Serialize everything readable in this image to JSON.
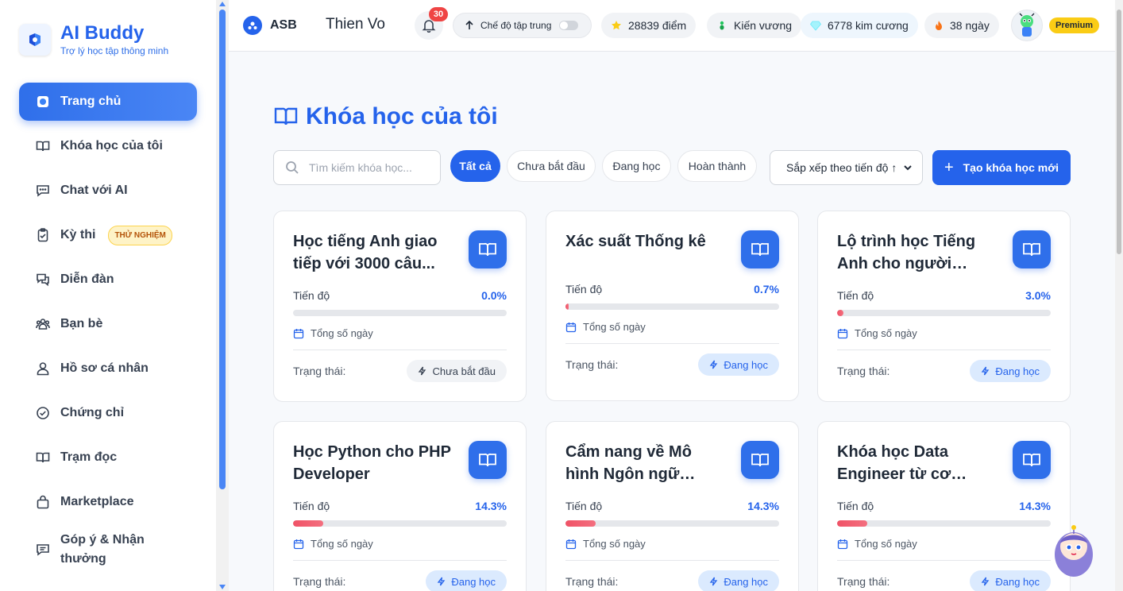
{
  "brand": {
    "title": "AI Buddy",
    "subtitle": "Trợ lý học tập thông minh"
  },
  "sidebar": {
    "items": [
      {
        "label": "Trang chủ",
        "icon": "home-icon",
        "active": true
      },
      {
        "label": "Khóa học của tôi",
        "icon": "book-icon"
      },
      {
        "label": "Chat với AI",
        "icon": "chat-icon"
      },
      {
        "label": "Kỳ thi",
        "icon": "clipboard-check-icon",
        "badge": "THỬ NGHIỆM"
      },
      {
        "label": "Diễn đàn",
        "icon": "forum-icon"
      },
      {
        "label": "Bạn bè",
        "icon": "users-icon"
      },
      {
        "label": "Hồ sơ cá nhân",
        "icon": "user-icon"
      },
      {
        "label": "Chứng chỉ",
        "icon": "check-circle-icon"
      },
      {
        "label": "Trạm đọc",
        "icon": "book-open-icon"
      },
      {
        "label": "Marketplace",
        "icon": "bag-icon"
      },
      {
        "label": "Góp ý & Nhận thưởng",
        "icon": "feedback-icon"
      }
    ]
  },
  "header": {
    "org": "ASB",
    "user": "Thien Vo",
    "notifications": "30",
    "focus_mode": "Chế độ tập trung",
    "points": "28839 điểm",
    "rank": "Kiến vương",
    "diamonds": "6778 kim cương",
    "streak": "38 ngày",
    "plan": "Premium"
  },
  "page": {
    "title": "Khóa học của tôi",
    "search_placeholder": "Tìm kiếm khóa học...",
    "filters": [
      "Tất cả",
      "Chưa bắt đầu",
      "Đang học",
      "Hoàn thành"
    ],
    "sort": "Sắp xếp theo tiến độ ↑",
    "create": "Tạo khóa học mới"
  },
  "card_labels": {
    "progress": "Tiến độ",
    "days": "Tổng số ngày",
    "status": "Trạng thái:"
  },
  "courses": [
    {
      "title": "Học tiếng Anh giao tiếp với 3000 câu...",
      "progress_text": "0.0%",
      "progress": 0.0,
      "status": "Chưa bắt đầu",
      "status_type": "notstarted"
    },
    {
      "title": "Xác suất Thống kê",
      "progress_text": "0.7%",
      "progress": 0.7,
      "status": "Đang học",
      "status_type": "learning"
    },
    {
      "title": "Lộ trình học Tiếng Anh cho người mất...",
      "progress_text": "3.0%",
      "progress": 3.0,
      "status": "Đang học",
      "status_type": "learning"
    },
    {
      "title": "Học Python cho PHP Developer",
      "progress_text": "14.3%",
      "progress": 14.3,
      "status": "Đang học",
      "status_type": "learning"
    },
    {
      "title": "Cẩm nang về Mô hình Ngôn ngữ Lớn...",
      "progress_text": "14.3%",
      "progress": 14.3,
      "status": "Đang học",
      "status_type": "learning"
    },
    {
      "title": "Khóa học Data Engineer từ cơ bản...",
      "progress_text": "14.3%",
      "progress": 14.3,
      "status": "Đang học",
      "status_type": "learning"
    }
  ],
  "colors": {
    "primary": "#2563eb",
    "progress": "#f05266",
    "premium": "#facc15",
    "notification": "#ef4444"
  }
}
